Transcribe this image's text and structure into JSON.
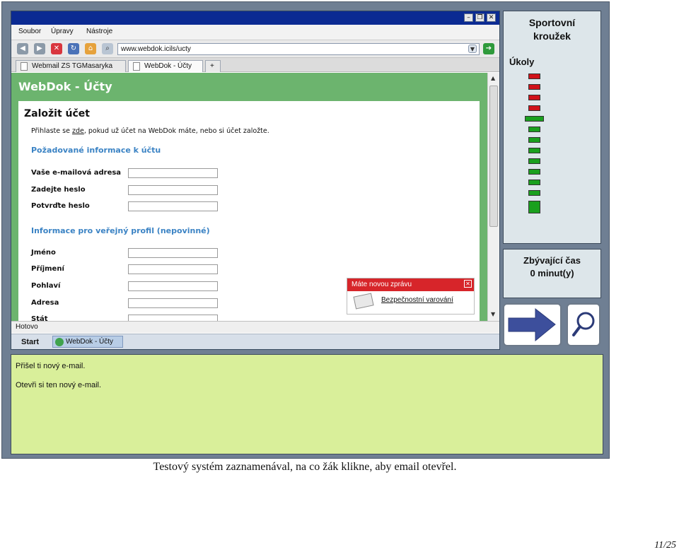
{
  "browser": {
    "menu": [
      "Soubor",
      "Úpravy",
      "Nástroje"
    ],
    "url": "www.webdok.icils/ucty",
    "tabs": [
      "Webmail ZS TGMasaryka",
      "WebDok - Účty",
      "+"
    ],
    "status": "Hotovo"
  },
  "page": {
    "header": "WebDok - Účty",
    "form_title": "Založit účet",
    "intro_before": "Přihlaste se ",
    "intro_link": "zde",
    "intro_after": ", pokud už účet na WebDok máte, nebo si účet založte.",
    "section_required": "Požadované informace k účtu",
    "required_fields": [
      "Vaše e-mailová adresa",
      "Zadejte heslo",
      "Potvrďte heslo"
    ],
    "section_optional": "Informace pro veřejný profil (nepovinné)",
    "optional_fields": [
      "Jméno",
      "Příjmení",
      "Pohlaví",
      "Adresa",
      "Stát"
    ]
  },
  "popup": {
    "title": "Máte novou zprávu",
    "link": "Bezpečnostní varování"
  },
  "taskbar": {
    "start": "Start",
    "item": "WebDok - Účty"
  },
  "side": {
    "title_line1": "Sportovní",
    "title_line2": "kroužek",
    "tasks_label": "Úkoly",
    "tasks": [
      "red",
      "red",
      "red",
      "red",
      "green-current",
      "green",
      "green",
      "green",
      "green",
      "green",
      "green",
      "green",
      "green-big"
    ],
    "time_label": "Zbývající čas",
    "time_value": "0 minut(y)"
  },
  "messages": [
    "Přišel ti nový e-mail.",
    "Otevři si ten nový e-mail."
  ],
  "caption": "Testový systém zaznamenával, na co žák klikne, aby email otevřel.",
  "page_number": "11/25",
  "colors": {
    "task_red": "#d0121a",
    "task_green": "#1aa01e",
    "page_green": "#6cb46e",
    "message_bg": "#d9ef9a",
    "arrow_blue": "#3d4f9c"
  }
}
